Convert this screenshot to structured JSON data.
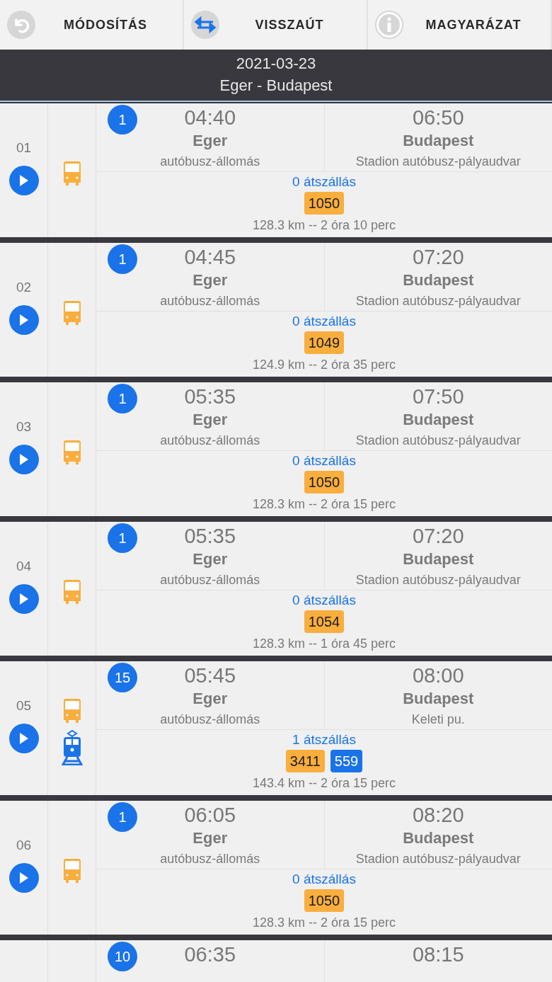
{
  "toolbar": [
    {
      "kind": "modify",
      "label": "MÓDOSÍTÁS"
    },
    {
      "kind": "return",
      "label": "VISSZAÚT"
    },
    {
      "kind": "info",
      "label": "MAGYARÁZAT"
    }
  ],
  "header": {
    "date": "2021-03-23",
    "route": "Eger - Budapest"
  },
  "trips": [
    {
      "number": "01",
      "legs": [
        {
          "kind": "bus"
        }
      ],
      "badge": "1",
      "departure": {
        "time": "04:40",
        "city": "Eger",
        "station": "autóbusz-állomás"
      },
      "arrival": {
        "time": "06:50",
        "city": "Budapest",
        "station": "Stadion autóbusz-pályaudvar"
      },
      "transfers": "0 átszállás",
      "lines": [
        {
          "text": "1050",
          "kind": "bus"
        }
      ],
      "distance": "128.3 km -- 2 óra 10 perc"
    },
    {
      "number": "02",
      "legs": [
        {
          "kind": "bus"
        }
      ],
      "badge": "1",
      "departure": {
        "time": "04:45",
        "city": "Eger",
        "station": "autóbusz-állomás"
      },
      "arrival": {
        "time": "07:20",
        "city": "Budapest",
        "station": "Stadion autóbusz-pályaudvar"
      },
      "transfers": "0 átszállás",
      "lines": [
        {
          "text": "1049",
          "kind": "bus"
        }
      ],
      "distance": "124.9 km -- 2 óra 35 perc"
    },
    {
      "number": "03",
      "legs": [
        {
          "kind": "bus"
        }
      ],
      "badge": "1",
      "departure": {
        "time": "05:35",
        "city": "Eger",
        "station": "autóbusz-állomás"
      },
      "arrival": {
        "time": "07:50",
        "city": "Budapest",
        "station": "Stadion autóbusz-pályaudvar"
      },
      "transfers": "0 átszállás",
      "lines": [
        {
          "text": "1050",
          "kind": "bus"
        }
      ],
      "distance": "128.3 km -- 2 óra 15 perc"
    },
    {
      "number": "04",
      "legs": [
        {
          "kind": "bus"
        }
      ],
      "badge": "1",
      "departure": {
        "time": "05:35",
        "city": "Eger",
        "station": "autóbusz-állomás"
      },
      "arrival": {
        "time": "07:20",
        "city": "Budapest",
        "station": "Stadion autóbusz-pályaudvar"
      },
      "transfers": "0 átszállás",
      "lines": [
        {
          "text": "1054",
          "kind": "bus"
        }
      ],
      "distance": "128.3 km -- 1 óra 45 perc"
    },
    {
      "number": "05",
      "legs": [
        {
          "kind": "bus"
        },
        {
          "kind": "train"
        }
      ],
      "badge": "15",
      "departure": {
        "time": "05:45",
        "city": "Eger",
        "station": "autóbusz-állomás"
      },
      "arrival": {
        "time": "08:00",
        "city": "Budapest",
        "station": "Keleti pu."
      },
      "transfers": "1 átszállás",
      "lines": [
        {
          "text": "3411",
          "kind": "bus"
        },
        {
          "text": "559",
          "kind": "train"
        }
      ],
      "distance": "143.4 km -- 2 óra 15 perc"
    },
    {
      "number": "06",
      "legs": [
        {
          "kind": "bus"
        }
      ],
      "badge": "1",
      "departure": {
        "time": "06:05",
        "city": "Eger",
        "station": "autóbusz-állomás"
      },
      "arrival": {
        "time": "08:20",
        "city": "Budapest",
        "station": "Stadion autóbusz-pályaudvar"
      },
      "transfers": "0 átszállás",
      "lines": [
        {
          "text": "1050",
          "kind": "bus"
        }
      ],
      "distance": "128.3 km -- 2 óra 15 perc"
    },
    {
      "badge": "10",
      "departure": {
        "time": "06:35"
      },
      "arrival": {
        "time": "08:15"
      }
    }
  ]
}
